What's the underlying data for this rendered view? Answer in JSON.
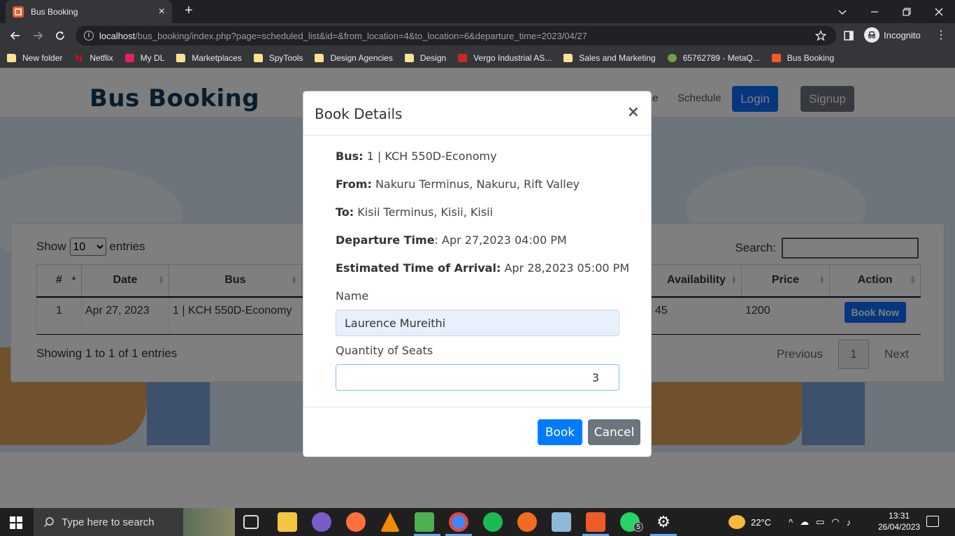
{
  "browser": {
    "tab_title": "Bus Booking",
    "new_tab": "+",
    "url_host": "localhost",
    "url_path": "/bus_booking/index.php?page=scheduled_list&id=&from_location=4&to_location=6&departure_time=2023/04/27",
    "profile_label": "Incognito"
  },
  "bookmarks": [
    {
      "label": "New folder",
      "icon": "folder"
    },
    {
      "label": "Netflix",
      "icon": "netflix"
    },
    {
      "label": "My DL",
      "icon": "mydl"
    },
    {
      "label": "Marketplaces",
      "icon": "folder"
    },
    {
      "label": "SpyTools",
      "icon": "folder"
    },
    {
      "label": "Design Agencies",
      "icon": "folder"
    },
    {
      "label": "Design",
      "icon": "folder"
    },
    {
      "label": "Vergo Industrial AS...",
      "icon": "vergo"
    },
    {
      "label": "Sales and Marketing",
      "icon": "folder"
    },
    {
      "label": "65762789 - MetaQ...",
      "icon": "meta"
    },
    {
      "label": "Bus Booking",
      "icon": "bus"
    }
  ],
  "site": {
    "logo": "Bus Booking",
    "nav_partial": "ne",
    "nav_schedule": "Schedule",
    "login": "Login",
    "signup": "Signup"
  },
  "table": {
    "show": "Show",
    "entries_select": "10",
    "entries": "entries",
    "search_label": "Search:",
    "headers": [
      "#",
      "Date",
      "Bus",
      "Availability",
      "Price",
      "Action"
    ],
    "row": {
      "num": "1",
      "date": "Apr 27, 2023",
      "bus": "1 | KCH 550D-Economy",
      "availability": "45",
      "price": "1200",
      "action": "Book Now"
    },
    "info": "Showing 1 to 1 of 1 entries",
    "previous": "Previous",
    "page": "1",
    "next": "Next"
  },
  "modal": {
    "title": "Book Details",
    "close": "×",
    "bus_label": "Bus:",
    "bus_value": "1 | KCH 550D-Economy",
    "from_label": "From:",
    "from_value": "Nakuru Terminus, Nakuru, Rift Valley",
    "to_label": "To:",
    "to_value": "Kisii Terminus, Kisii, Kisii",
    "departure_label": "Departure Time",
    "departure_value": ": Apr 27,2023 04:00 PM",
    "eta_label": "Estimated Time of Arrival:",
    "eta_value": "Apr 28,2023 05:00 PM",
    "name_label": "Name",
    "name_value": "Laurence Mureithi",
    "qty_label": "Quantity of Seats",
    "qty_value": "3",
    "book": "Book",
    "cancel": "Cancel"
  },
  "taskbar": {
    "search_placeholder": "Type here to search",
    "temperature": "22°C",
    "time": "13:31",
    "date": "26/04/2023",
    "whatsapp_badge": "5"
  }
}
